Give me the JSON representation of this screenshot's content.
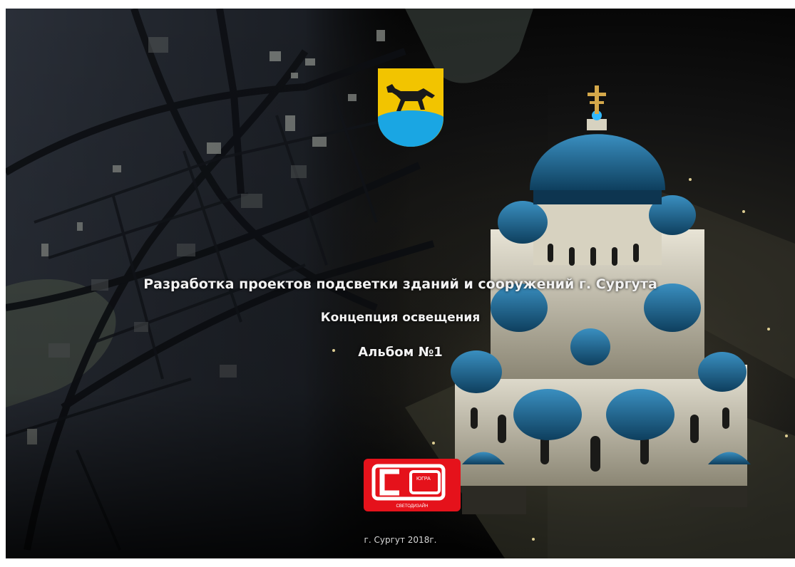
{
  "cover": {
    "title": "Разработка проектов подсветки зданий и сооружений г. Сургута",
    "subtitle": "Концепция освещения",
    "album": "Альбом №1",
    "footer": "г. Сургут 2018г."
  },
  "logo": {
    "top_text": "ЮГРА",
    "bottom_text": "СВЕТОДИЗАЙН"
  },
  "colors": {
    "accent_red": "#e5121b",
    "dome_blue": "#1f6f9a",
    "crest_yellow": "#f2c400",
    "crest_blue": "#1aa6e3"
  },
  "icons": {
    "crest": "coat-of-arms-icon",
    "logo": "svetodizain-logo-icon"
  }
}
